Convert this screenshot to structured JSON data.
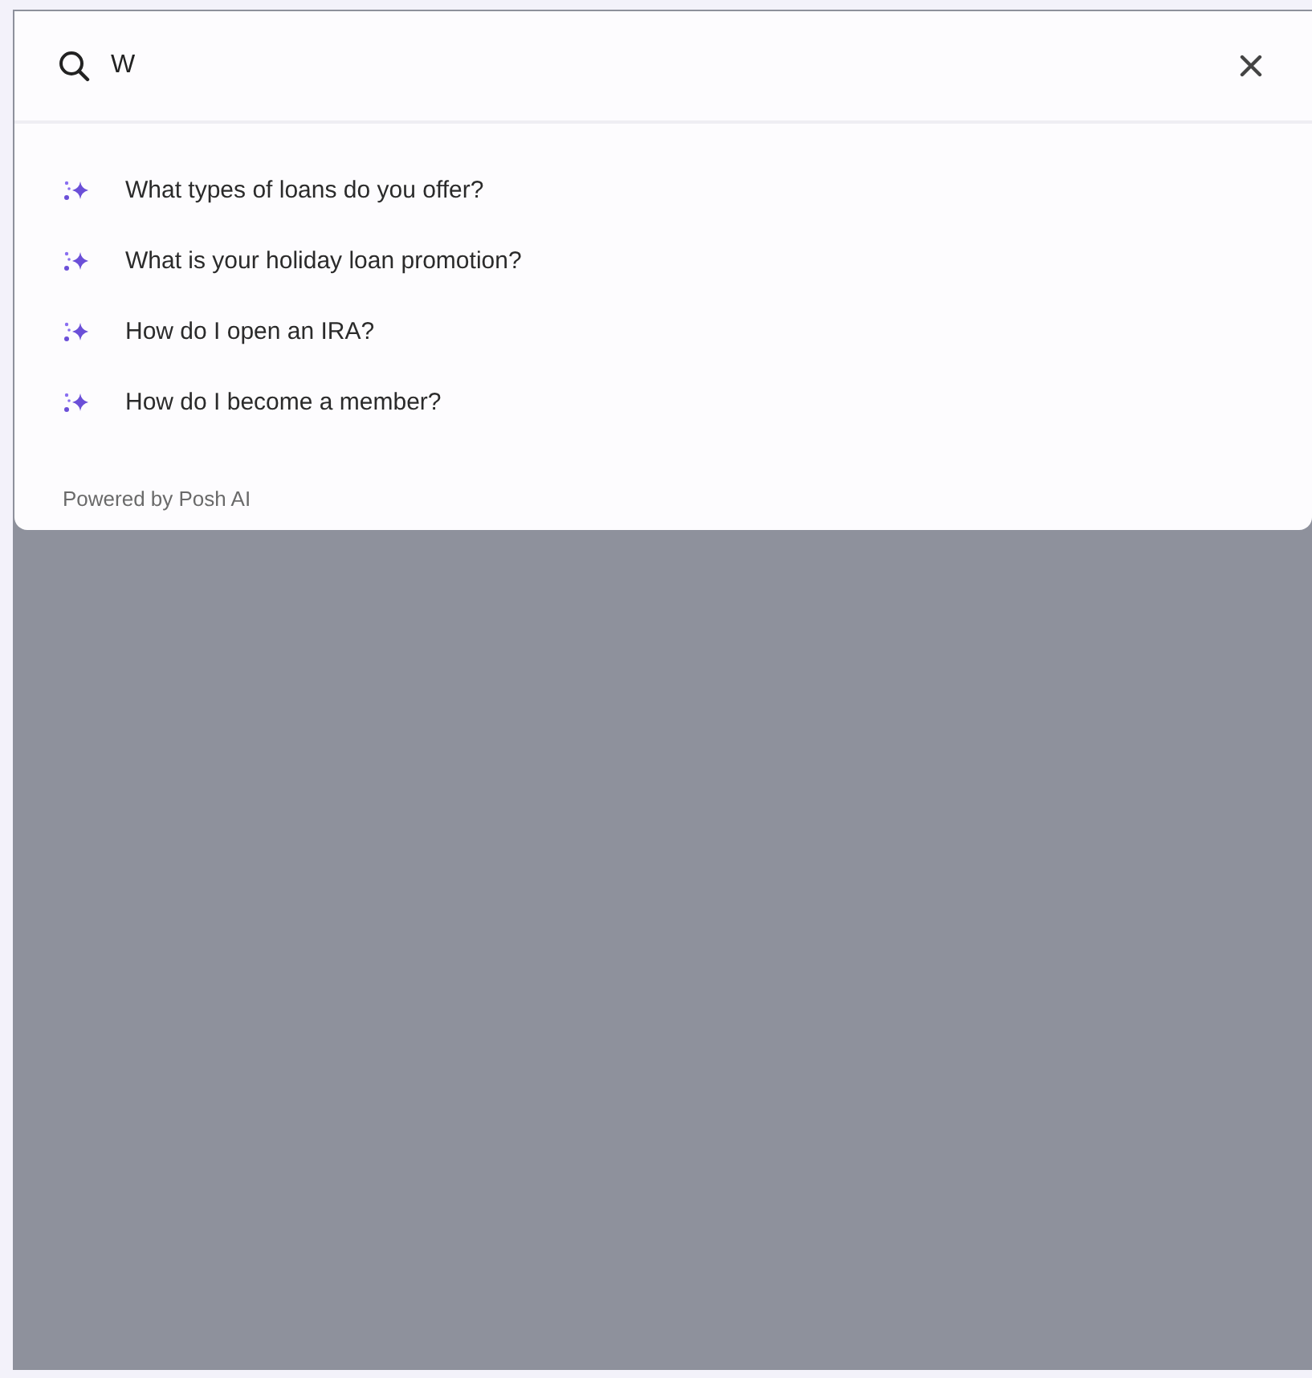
{
  "search": {
    "value": "W"
  },
  "suggestions": [
    {
      "text": "What types of loans do you offer?"
    },
    {
      "text": "What is your holiday loan promotion?"
    },
    {
      "text": "How do I open an IRA?"
    },
    {
      "text": "How do I become a member?"
    }
  ],
  "footer": "Powered by Posh AI"
}
